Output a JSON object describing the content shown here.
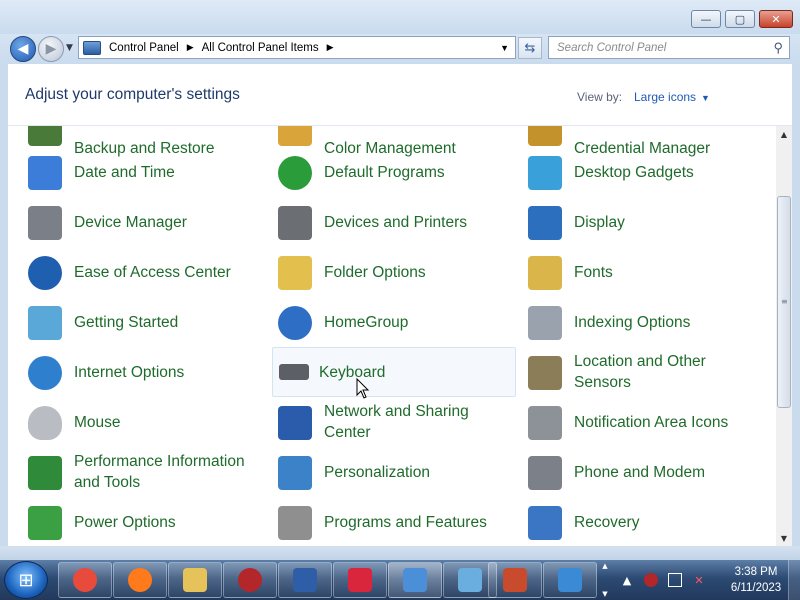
{
  "window": {
    "minimize_label": "—",
    "maximize_label": "▢",
    "close_label": "✕"
  },
  "navbar": {
    "back_label": "◀",
    "forward_label": "▶",
    "history_dropdown": "▼",
    "breadcrumbs": [
      "Control Panel",
      "All Control Panel Items"
    ],
    "crumb_separator": "▶",
    "address_dropdown": "▼",
    "refresh_label": "⇆",
    "search_placeholder": "Search Control Panel",
    "search_icon": "⚲"
  },
  "header": {
    "title": "Adjust your computer's settings",
    "view_by_label": "View by:",
    "view_by_value": "Large icons",
    "view_by_arrow": "▼"
  },
  "items": {
    "row0": [
      "Backup and Restore",
      "Color Management",
      "Credential Manager"
    ],
    "row1": [
      "Date and Time",
      "Default Programs",
      "Desktop Gadgets"
    ],
    "row2": [
      "Device Manager",
      "Devices and Printers",
      "Display"
    ],
    "row3": [
      "Ease of Access Center",
      "Folder Options",
      "Fonts"
    ],
    "row4": [
      "Getting Started",
      "HomeGroup",
      "Indexing Options"
    ],
    "row5": [
      "Internet Options",
      "Keyboard",
      "Location and Other Sensors"
    ],
    "row6": [
      "Mouse",
      "Network and Sharing Center",
      "Notification Area Icons"
    ],
    "row7": [
      "Performance Information and Tools",
      "Personalization",
      "Phone and Modem"
    ],
    "row8": [
      "Power Options",
      "Programs and Features",
      "Recovery"
    ]
  },
  "icons": {
    "colors": {
      "backup": "#4a7a3a",
      "color": "#d9a43a",
      "credential": "#c4922c",
      "datetime": "#3b7dd8",
      "default": "#2a9d3a",
      "gadgets": "#3aa0d9",
      "device": "#7a7f88",
      "printers": "#6b6e73",
      "display": "#2c6fbf",
      "ease": "#1f5fb0",
      "folder": "#e3c04d",
      "fonts": "#d9b54a",
      "started": "#5aa8d8",
      "homegroup": "#2e6ec4",
      "indexing": "#9aa3ad",
      "internet": "#2f7fcf",
      "keyboard": "#5c5f66",
      "location": "#8b7d57",
      "mouse": "#b9bdc3",
      "network": "#2b5cab",
      "notification": "#8d9299",
      "performance": "#2f8a3a",
      "personalization": "#3c82c8",
      "phone": "#7c8089",
      "power": "#3aa043",
      "programs": "#8f8f8f",
      "recovery": "#3a76c4"
    }
  },
  "scrollbar": {
    "up_arrow": "▲",
    "down_arrow": "▼",
    "grip": "≡"
  },
  "taskbar": {
    "start_glyph": "⊞",
    "scroll_up": "▲",
    "scroll_down": "▼",
    "tray_expand": "▲",
    "clock_time": "3:38 PM",
    "clock_date": "6/11/2023",
    "app_colors": [
      "#e84b3c",
      "#ff7a1a",
      "#e6c25a",
      "#b3262a",
      "#2e5ea8",
      "#d9263c",
      "#4a8fd8",
      "#6aaee0",
      "#c94b2e",
      "#3a8ad6"
    ]
  }
}
